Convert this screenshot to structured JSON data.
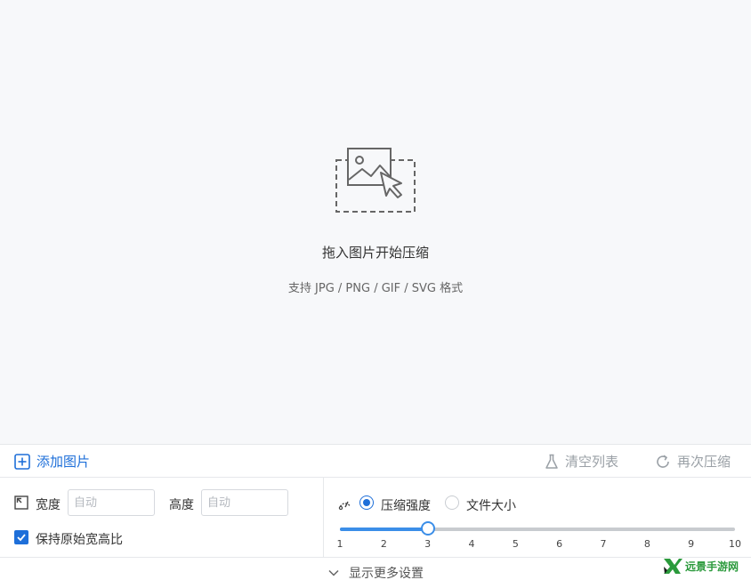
{
  "drop_area": {
    "title": "拖入图片开始压缩",
    "subtitle": "支持 JPG / PNG / GIF / SVG 格式",
    "icon": "image-drop-icon"
  },
  "toolbar": {
    "add_label": "添加图片",
    "clear_label": "清空列表",
    "recompress_label": "再次压缩"
  },
  "settings": {
    "width_label": "宽度",
    "width_placeholder": "自动",
    "width_value": "",
    "height_label": "高度",
    "height_placeholder": "自动",
    "height_value": "",
    "keep_ratio_label": "保持原始宽高比",
    "keep_ratio_checked": true,
    "mode_options": [
      {
        "label": "压缩强度",
        "selected": true
      },
      {
        "label": "文件大小",
        "selected": false
      }
    ],
    "slider": {
      "min": 1,
      "max": 10,
      "value": 3,
      "ticks": [
        "1",
        "2",
        "3",
        "4",
        "5",
        "6",
        "7",
        "8",
        "9",
        "10"
      ]
    }
  },
  "footer": {
    "more_label": "显示更多设置"
  },
  "watermark": {
    "text": "远景手游网"
  },
  "colors": {
    "accent": "#1e6fd9",
    "slider": "#3b8ee8",
    "background": "#f7f8fa",
    "disabled": "#9aa0a6"
  }
}
